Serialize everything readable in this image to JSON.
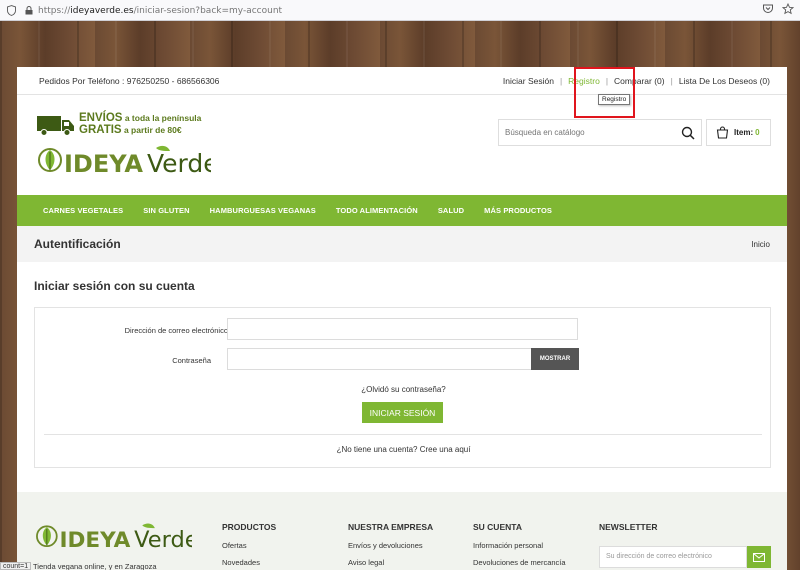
{
  "browser": {
    "url_prefix": "https://",
    "url_domain": "ideyaverde.es",
    "url_path": "/iniciar-sesion?back=my-account"
  },
  "header": {
    "phone": "Pedidos Por Teléfono : 976250250 - 686566306",
    "links": {
      "login": "Iniciar Sesión",
      "register": "Registro",
      "compare": "Comparar (0)",
      "wishlist": "Lista De Los Deseos (0)"
    },
    "tooltip": "Registro",
    "shipping_line1_big": "ENVÍOS",
    "shipping_line1_small": " a toda la península",
    "shipping_line2_big": "GRATIS",
    "shipping_line2_small": " a partir de 80€",
    "logo_text_left": "IDEYA",
    "logo_text_right": "Verde",
    "search_placeholder": "Búsqueda en catálogo",
    "cart_label": "Item:",
    "cart_count": "0"
  },
  "nav": {
    "items": [
      "CARNES VEGETALES",
      "SIN GLUTEN",
      "HAMBURGUESAS VEGANAS",
      "TODO ALIMENTACIÓN",
      "SALUD",
      "MÁS PRODUCTOS"
    ]
  },
  "breadcrumb": {
    "title": "Autentificación",
    "home": "Inicio"
  },
  "login": {
    "title": "Iniciar sesión con su cuenta",
    "email_label": "Dirección de correo electrónico",
    "password_label": "Contraseña",
    "show_button": "MOSTRAR",
    "forgot": "¿Olvidó su contraseña?",
    "submit": "INICIAR SESIÓN",
    "no_account": "¿No tiene una cuenta? Cree una aquí"
  },
  "footer": {
    "tagline": "Tienda vegana online, y en Zaragoza",
    "products_title": "PRODUCTOS",
    "products_items": [
      "Ofertas",
      "Novedades"
    ],
    "company_title": "NUESTRA EMPRESA",
    "company_items": [
      "Envíos y devoluciones",
      "Aviso legal"
    ],
    "account_title": "SU CUENTA",
    "account_items": [
      "Información personal",
      "Devoluciones de mercancía"
    ],
    "newsletter_title": "NEWSLETTER",
    "newsletter_placeholder": "Su dirección de correo electrónico"
  },
  "status_bar": "count=1",
  "colors": {
    "accent": "#7fb733",
    "highlight_box": "#e0151d"
  }
}
